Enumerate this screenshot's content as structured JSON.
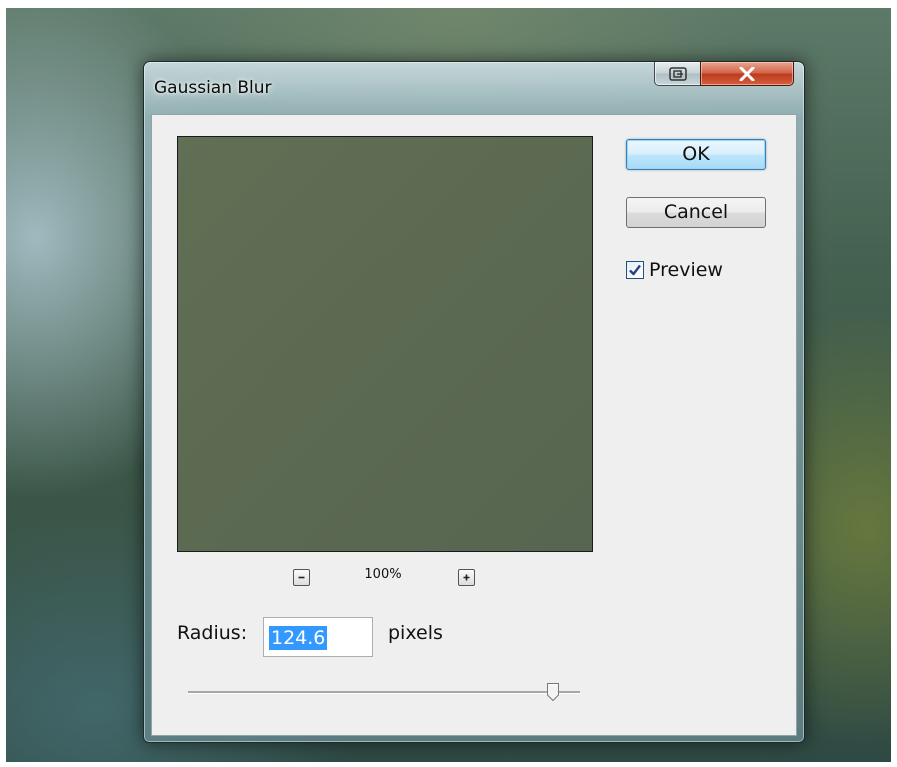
{
  "window": {
    "title": "Gaussian Blur",
    "help_icon": "help-context-icon",
    "close_icon": "close-x-icon"
  },
  "preview": {
    "zoom_level": "100%",
    "zoom_out_icon": "minus-icon",
    "zoom_in_icon": "plus-icon",
    "preview_color": "#5d6b53"
  },
  "buttons": {
    "ok_label": "OK",
    "cancel_label": "Cancel"
  },
  "preview_toggle": {
    "label": "Preview",
    "checked": true
  },
  "radius": {
    "label": "Radius:",
    "value": "124.6",
    "unit": "pixels",
    "slider_fraction": 0.93
  },
  "colors": {
    "close_button": "#c7462a",
    "selection": "#3399ff",
    "default_button_border": "#3c7fb1"
  }
}
